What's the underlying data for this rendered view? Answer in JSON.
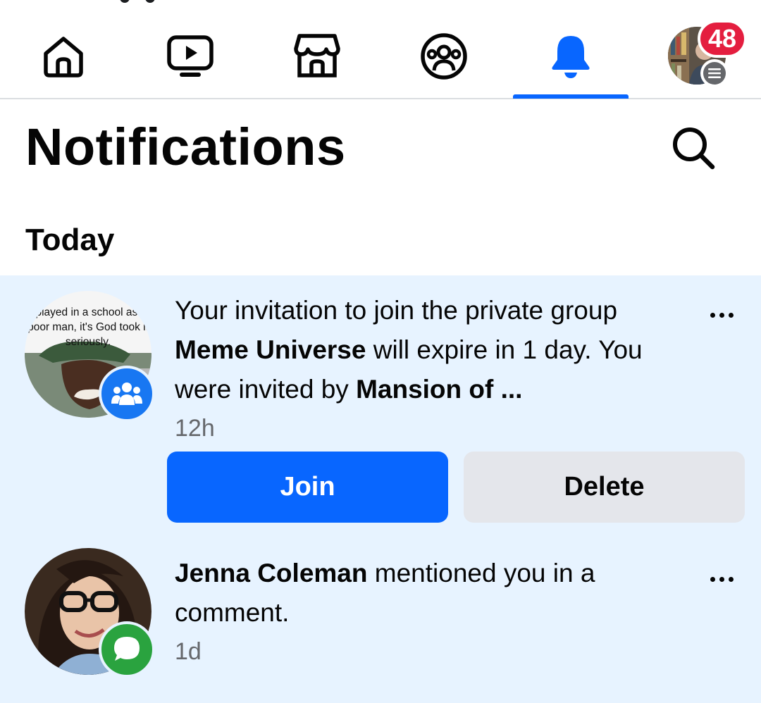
{
  "nav": {
    "tabs": [
      {
        "name": "home",
        "icon": "home-icon"
      },
      {
        "name": "video",
        "icon": "video-icon"
      },
      {
        "name": "marketplace",
        "icon": "marketplace-icon"
      },
      {
        "name": "groups",
        "icon": "groups-icon"
      },
      {
        "name": "notifications",
        "icon": "bell-icon",
        "active": true
      },
      {
        "name": "menu",
        "icon": "profile-avatar"
      }
    ],
    "notification_count": "48",
    "accent_color": "#0866ff",
    "badge_color": "#e41e3f"
  },
  "header": {
    "title": "Notifications",
    "search_icon": "search-icon"
  },
  "sections": {
    "today_label": "Today"
  },
  "notifications": [
    {
      "thumbnail_caption": "I played in a school as a poor man, it's God took it seriously.",
      "badge_icon": "groups-icon",
      "text_before": "Your invitation to join the private group ",
      "group_name": "Meme Universe",
      "text_middle": " will expire in 1 day. You were invited by ",
      "inviter": "Mansion of ...",
      "time": "12h",
      "join_label": "Join",
      "delete_label": "Delete"
    },
    {
      "badge_icon": "comment-icon",
      "actor": "Jenna Coleman",
      "text": " mentioned you in a comment.",
      "time": "1d"
    }
  ]
}
